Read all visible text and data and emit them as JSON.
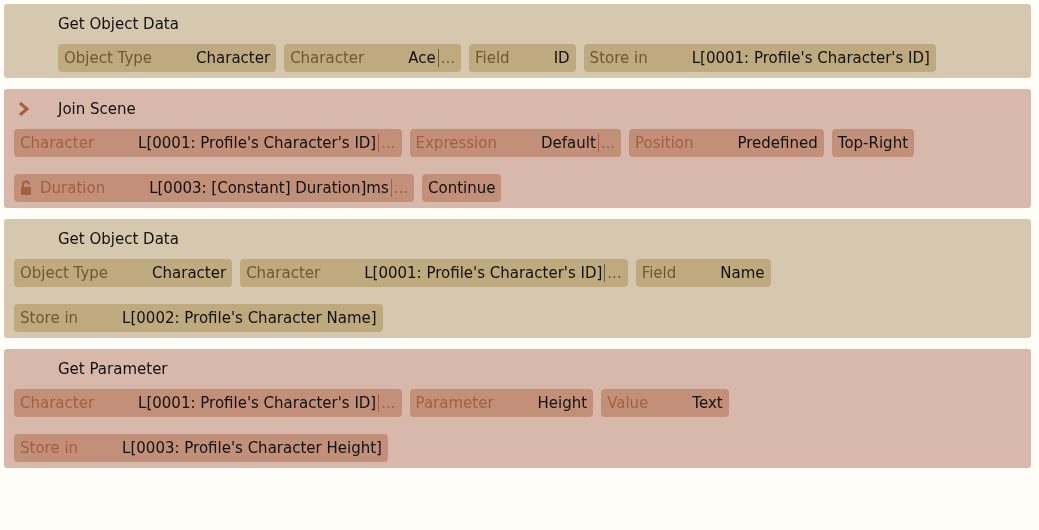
{
  "blocks": [
    {
      "kind": "data",
      "title": "Get Object Data",
      "compact": true,
      "rows": [
        [
          {
            "label": "Object Type",
            "value": "Character"
          },
          {
            "label": "Character",
            "value": "Ace",
            "more": "..."
          },
          {
            "label": "Field",
            "value": "ID"
          },
          {
            "label": "Store in",
            "value": "L[0001: Profile's Character's ID]"
          }
        ]
      ]
    },
    {
      "kind": "action",
      "title": "Join Scene",
      "expanded": false,
      "rows": [
        [
          {
            "label": "Character",
            "value": "L[0001: Profile's Character's ID]",
            "more": "..."
          },
          {
            "label": "Expression",
            "value": "Default",
            "more": "..."
          },
          {
            "label": "Position",
            "value": "Predefined"
          },
          {
            "value": "Top-Right"
          }
        ],
        [
          {
            "label": "Duration",
            "locked": false,
            "value": "L[0003: [Constant] Duration]ms",
            "more": "..."
          },
          {
            "value": "Continue"
          }
        ]
      ]
    },
    {
      "kind": "data",
      "title": "Get Object Data",
      "rows": [
        [
          {
            "label": "Object Type",
            "value": "Character"
          },
          {
            "label": "Character",
            "value": "L[0001: Profile's Character's ID]",
            "more": "..."
          },
          {
            "label": "Field",
            "value": "Name"
          }
        ],
        [
          {
            "label": "Store in",
            "value": "L[0002: Profile's Character Name]"
          }
        ]
      ]
    },
    {
      "kind": "action",
      "title": "Get Parameter",
      "rows": [
        [
          {
            "label": "Character",
            "value": "L[0001: Profile's Character's ID]",
            "more": "..."
          },
          {
            "label": "Parameter",
            "value": "Height"
          },
          {
            "label": "Value",
            "value": "Text"
          }
        ],
        [
          {
            "label": "Store in",
            "value": "L[0003: Profile's Character Height]"
          }
        ]
      ]
    }
  ]
}
